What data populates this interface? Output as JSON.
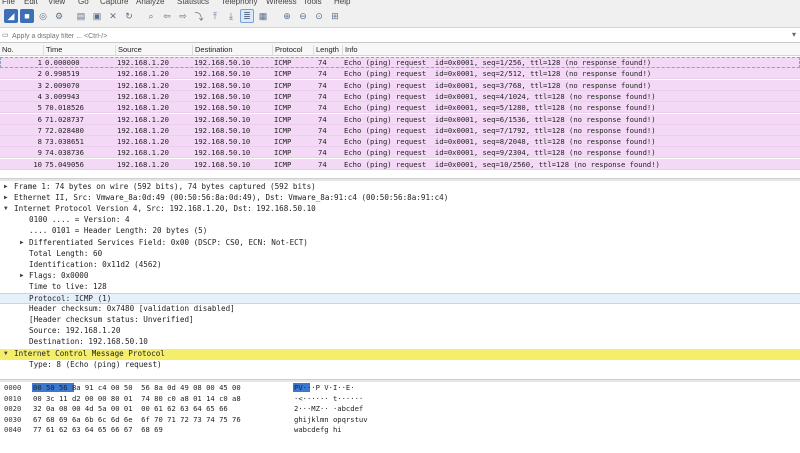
{
  "menu": [
    "File",
    "Edit",
    "View",
    "Go",
    "Capture",
    "Analyze",
    "Statistics",
    "Telephony",
    "Wireless",
    "Tools",
    "Help"
  ],
  "filter": {
    "placeholder": "Apply a display filter ... <Ctrl-/>"
  },
  "columns": [
    "No.",
    "Time",
    "Source",
    "Destination",
    "Protocol",
    "Length",
    "Info"
  ],
  "packets": [
    {
      "no": "1",
      "time": "0.000000",
      "src": "192.168.1.20",
      "dst": "192.168.50.10",
      "proto": "ICMP",
      "len": "74",
      "info": "Echo (ping) request  id=0x0001, seq=1/256, ttl=128 (no response found!)"
    },
    {
      "no": "2",
      "time": "0.998519",
      "src": "192.168.1.20",
      "dst": "192.168.50.10",
      "proto": "ICMP",
      "len": "74",
      "info": "Echo (ping) request  id=0x0001, seq=2/512, ttl=128 (no response found!)"
    },
    {
      "no": "3",
      "time": "2.009070",
      "src": "192.168.1.20",
      "dst": "192.168.50.10",
      "proto": "ICMP",
      "len": "74",
      "info": "Echo (ping) request  id=0x0001, seq=3/768, ttl=128 (no response found!)"
    },
    {
      "no": "4",
      "time": "3.009943",
      "src": "192.168.1.20",
      "dst": "192.168.50.10",
      "proto": "ICMP",
      "len": "74",
      "info": "Echo (ping) request  id=0x0001, seq=4/1024, ttl=128 (no response found!)"
    },
    {
      "no": "5",
      "time": "70.018526",
      "src": "192.168.1.20",
      "dst": "192.168.50.10",
      "proto": "ICMP",
      "len": "74",
      "info": "Echo (ping) request  id=0x0001, seq=5/1280, ttl=128 (no response found!)"
    },
    {
      "no": "6",
      "time": "71.028737",
      "src": "192.168.1.20",
      "dst": "192.168.50.10",
      "proto": "ICMP",
      "len": "74",
      "info": "Echo (ping) request  id=0x0001, seq=6/1536, ttl=128 (no response found!)"
    },
    {
      "no": "7",
      "time": "72.028480",
      "src": "192.168.1.20",
      "dst": "192.168.50.10",
      "proto": "ICMP",
      "len": "74",
      "info": "Echo (ping) request  id=0x0001, seq=7/1792, ttl=128 (no response found!)"
    },
    {
      "no": "8",
      "time": "73.038651",
      "src": "192.168.1.20",
      "dst": "192.168.50.10",
      "proto": "ICMP",
      "len": "74",
      "info": "Echo (ping) request  id=0x0001, seq=8/2048, ttl=128 (no response found!)"
    },
    {
      "no": "9",
      "time": "74.038736",
      "src": "192.168.1.20",
      "dst": "192.168.50.10",
      "proto": "ICMP",
      "len": "74",
      "info": "Echo (ping) request  id=0x0001, seq=9/2304, ttl=128 (no response found!)"
    },
    {
      "no": "10",
      "time": "75.049056",
      "src": "192.168.1.20",
      "dst": "192.168.50.10",
      "proto": "ICMP",
      "len": "74",
      "info": "Echo (ping) request  id=0x0001, seq=10/2560, ttl=128 (no response found!)"
    }
  ],
  "details": [
    {
      "indent": 0,
      "arrow": "right",
      "text": "Frame 1: 74 bytes on wire (592 bits), 74 bytes captured (592 bits)"
    },
    {
      "indent": 0,
      "arrow": "right",
      "text": "Ethernet II, Src: Vmware_8a:0d:49 (00:50:56:8a:0d:49), Dst: Vmware_8a:91:c4 (00:50:56:8a:91:c4)"
    },
    {
      "indent": 0,
      "arrow": "down",
      "text": "Internet Protocol Version 4, Src: 192.168.1.20, Dst: 192.168.50.10"
    },
    {
      "indent": 1,
      "arrow": "",
      "text": "0100 .... = Version: 4"
    },
    {
      "indent": 1,
      "arrow": "",
      "text": ".... 0101 = Header Length: 20 bytes (5)"
    },
    {
      "indent": 1,
      "arrow": "right",
      "text": "Differentiated Services Field: 0x00 (DSCP: CS0, ECN: Not-ECT)"
    },
    {
      "indent": 1,
      "arrow": "",
      "text": "Total Length: 60"
    },
    {
      "indent": 1,
      "arrow": "",
      "text": "Identification: 0x11d2 (4562)"
    },
    {
      "indent": 1,
      "arrow": "right",
      "text": "Flags: 0x0000"
    },
    {
      "indent": 1,
      "arrow": "",
      "text": "Time to live: 128"
    },
    {
      "indent": 1,
      "arrow": "",
      "text": "Protocol: ICMP (1)",
      "highlight": true
    },
    {
      "indent": 1,
      "arrow": "",
      "text": "Header checksum: 0x7480 [validation disabled]"
    },
    {
      "indent": 1,
      "arrow": "",
      "text": "[Header checksum status: Unverified]"
    },
    {
      "indent": 1,
      "arrow": "",
      "text": "Source: 192.168.1.20"
    },
    {
      "indent": 1,
      "arrow": "",
      "text": "Destination: 192.168.50.10"
    },
    {
      "indent": 0,
      "arrow": "down",
      "text": "Internet Control Message Protocol",
      "yellow": true
    },
    {
      "indent": 1,
      "arrow": "",
      "text": "Type: 8 (Echo (ping) request)"
    }
  ],
  "bytes": [
    {
      "off": "0000",
      "hex": "00 50 56 8a 91 c4 00 50  56 8a 0d 49 08 00 45 00",
      "ascii": "PV···P V·I··E·"
    },
    {
      "off": "0010",
      "hex": "00 3c 11 d2 00 00 80 01  74 80 c0 a8 01 14 c0 a8",
      "ascii": "·<······ t······"
    },
    {
      "off": "0020",
      "hex": "32 0a 08 00 4d 5a 00 01  00 61 62 63 64 65 66",
      "ascii": "2···MZ·· ·abcdef"
    },
    {
      "off": "0030",
      "hex": "67 68 69 6a 6b 6c 6d 6e  6f 70 71 72 73 74 75 76",
      "ascii": "ghijklmn opqrstuv"
    },
    {
      "off": "0040",
      "hex": "77 61 62 63 64 65 66 67  68 69",
      "ascii": "wabcdefg hi"
    }
  ]
}
